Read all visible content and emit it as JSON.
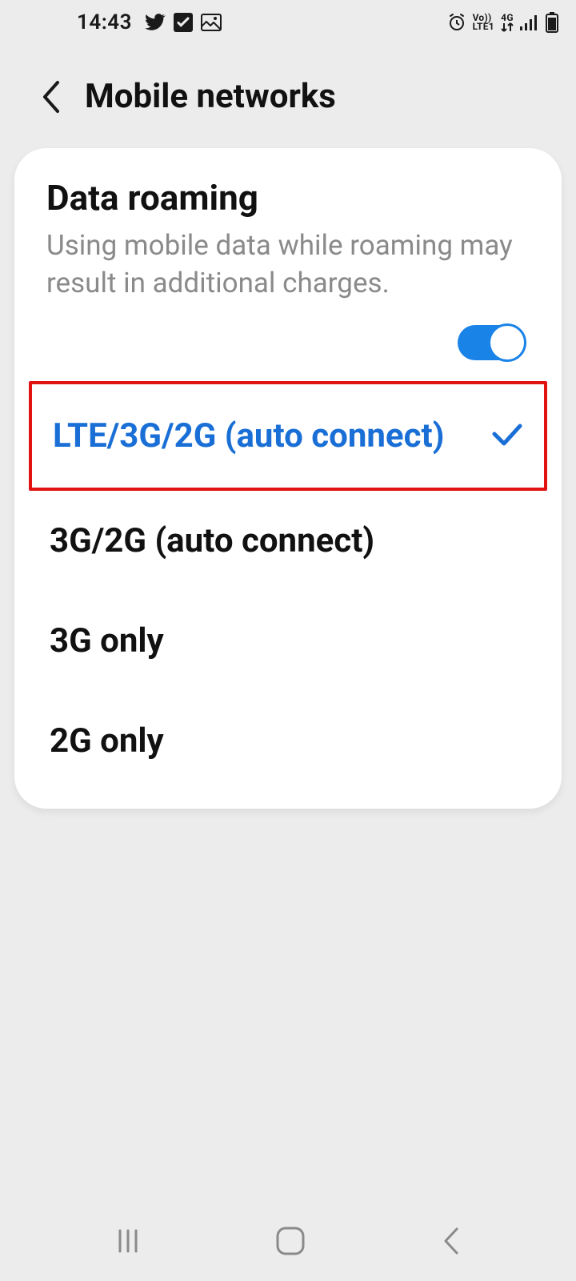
{
  "status_bar": {
    "time": "14:43",
    "volte_label_top": "Vo))",
    "volte_label_bottom": "LTE1",
    "net_gen": "4G"
  },
  "header": {
    "title": "Mobile networks"
  },
  "roaming": {
    "title": "Data roaming",
    "description": "Using mobile data while roaming may result in additional charges.",
    "enabled": true
  },
  "network_modes": {
    "selected_label": "LTE/3G/2G (auto connect)",
    "options": [
      "3G/2G (auto connect)",
      "3G only",
      "2G only"
    ]
  }
}
